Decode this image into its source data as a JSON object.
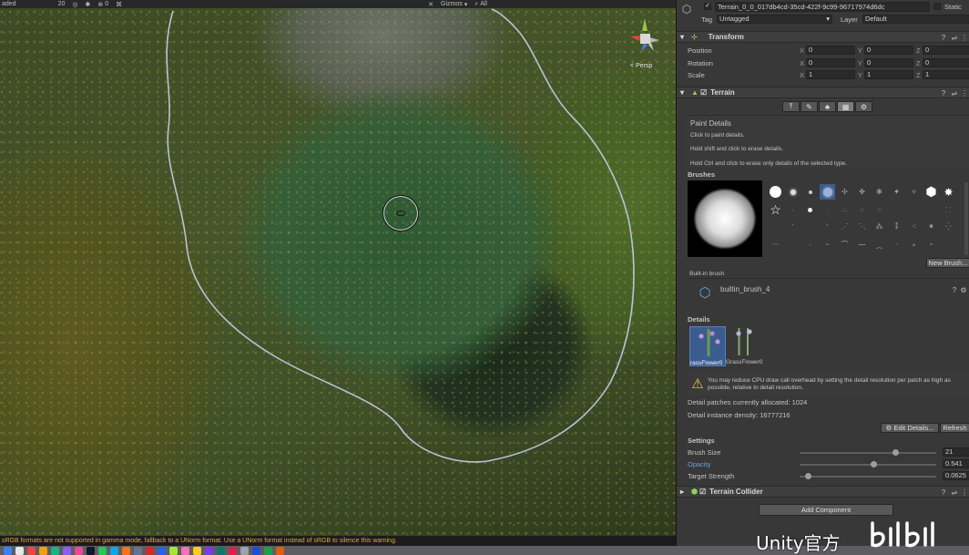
{
  "scene": {
    "toolbar": {
      "shading_mode": "aded",
      "scene_camera_value": "20",
      "audio_value": "0",
      "gizmos_label": "Gizmos",
      "search_value": "All"
    },
    "perspective_label": "< Persp",
    "status_message": "sRGB formats are not supported in gamma mode, fallback to a UNorm format. Use a UNorm format instead of sRGB to silence this warning."
  },
  "inspector": {
    "object_name": "Terrain_0_0_017db4cd-35cd-422f-9c99-96717974d6dc",
    "static_label": "Static",
    "tag_label": "Tag",
    "tag_value": "Untagged",
    "layer_label": "Layer",
    "layer_value": "Default",
    "transform": {
      "title": "Transform",
      "rows": [
        {
          "label": "Position",
          "x": "0",
          "y": "0",
          "z": "0"
        },
        {
          "label": "Rotation",
          "x": "0",
          "y": "0",
          "z": "0"
        },
        {
          "label": "Scale",
          "x": "1",
          "y": "1",
          "z": "1"
        }
      ],
      "axis_x": "X",
      "axis_y": "Y",
      "axis_z": "Z"
    },
    "terrain": {
      "title": "Terrain",
      "tool_title": "Paint Details",
      "hints": [
        "Click to paint details.",
        "Hold shift and click to erase details.",
        "Hold Ctrl and click to erase only details of the selected type."
      ],
      "brushes_label": "Brushes",
      "new_brush_label": "New Brush...",
      "builtin_label": "Built-in brush",
      "brush_name": "builtin_brush_4",
      "details_label": "Details",
      "detail_items": [
        "rassFlower0",
        "GrassFlower0"
      ],
      "warning": "You may reduce CPU draw call overhead by setting the detail resolution per patch as high as possible, relative to detail resolution.",
      "patches_text": "Detail patches currently allocated: 1024",
      "density_text": "Detail instance density: 16777216",
      "edit_details_label": "Edit Details...",
      "refresh_label": "Refresh",
      "settings_label": "Settings",
      "settings": [
        {
          "label": "Brush Size",
          "value": "21",
          "fraction": 0.7,
          "highlight": false
        },
        {
          "label": "Opacity",
          "value": "0.541",
          "fraction": 0.541,
          "highlight": true
        },
        {
          "label": "Target Strength",
          "value": "0.0625",
          "fraction": 0.0625,
          "highlight": false
        }
      ]
    },
    "collider": {
      "title": "Terrain Collider"
    },
    "add_component_label": "Add Component"
  },
  "watermark": {
    "text": "Unity官方"
  },
  "colors": {
    "warning_text": "#e2a83a",
    "selection_blue": "#3b5c8e",
    "highlight_label": "#6ea0e0"
  }
}
